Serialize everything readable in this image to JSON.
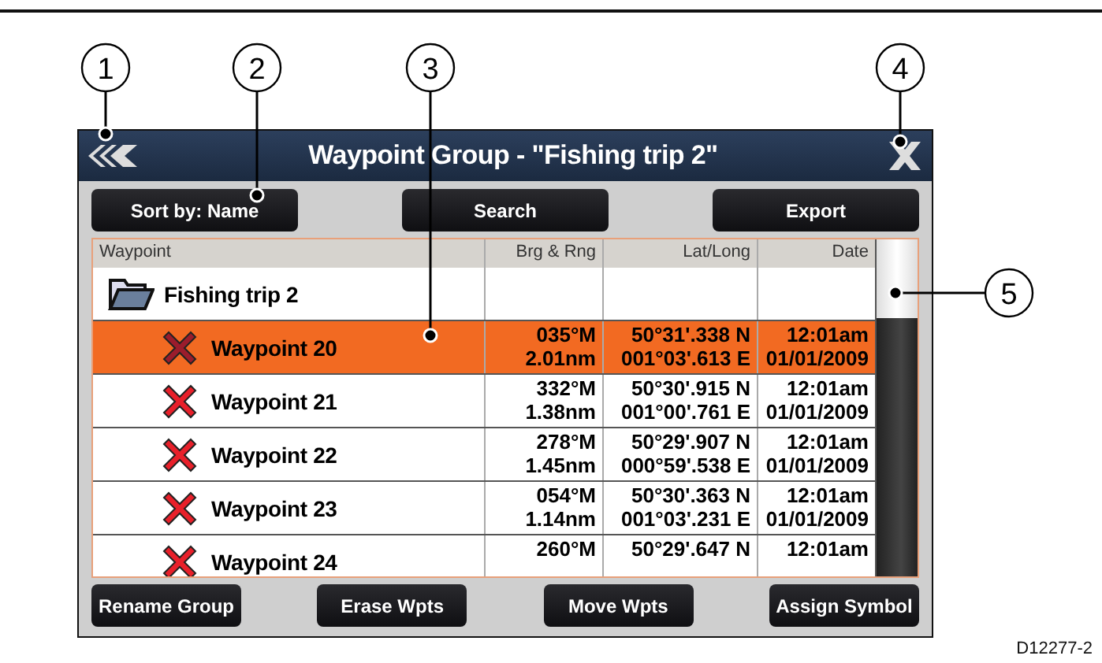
{
  "callouts": [
    "1",
    "2",
    "3",
    "4",
    "5"
  ],
  "window": {
    "title": "Waypoint Group - \"Fishing trip 2\""
  },
  "top_buttons": [
    "Sort by: Name",
    "Search",
    "Export"
  ],
  "table": {
    "columns": [
      "Waypoint",
      "Brg & Rng",
      "Lat/Long",
      "Date"
    ],
    "rows": [
      {
        "kind": "folder",
        "name": "Fishing trip 2",
        "selected": false
      },
      {
        "kind": "waypoint",
        "name": "Waypoint 20",
        "selected": true,
        "brg": "035°M",
        "rng": "2.01nm",
        "lat": "50°31'.338 N",
        "long": "001°03'.613 E",
        "time": "12:01am",
        "date": "01/01/2009"
      },
      {
        "kind": "waypoint",
        "name": "Waypoint 21",
        "selected": false,
        "brg": "332°M",
        "rng": "1.38nm",
        "lat": "50°30'.915 N",
        "long": "001°00'.761 E",
        "time": "12:01am",
        "date": "01/01/2009"
      },
      {
        "kind": "waypoint",
        "name": "Waypoint 22",
        "selected": false,
        "brg": "278°M",
        "rng": "1.45nm",
        "lat": "50°29'.907 N",
        "long": "000°59'.538 E",
        "time": "12:01am",
        "date": "01/01/2009"
      },
      {
        "kind": "waypoint",
        "name": "Waypoint 23",
        "selected": false,
        "brg": "054°M",
        "rng": "1.14nm",
        "lat": "50°30'.363 N",
        "long": "001°03'.231 E",
        "time": "12:01am",
        "date": "01/01/2009"
      },
      {
        "kind": "waypoint",
        "name": "Waypoint 24",
        "selected": false,
        "brg": "260°M",
        "lat": "50°29'.647 N",
        "time": "12:01am"
      }
    ]
  },
  "bottom_buttons": [
    "Rename Group",
    "Erase Wpts",
    "Move Wpts",
    "Assign Symbol"
  ],
  "figure_code": "D12277-2"
}
